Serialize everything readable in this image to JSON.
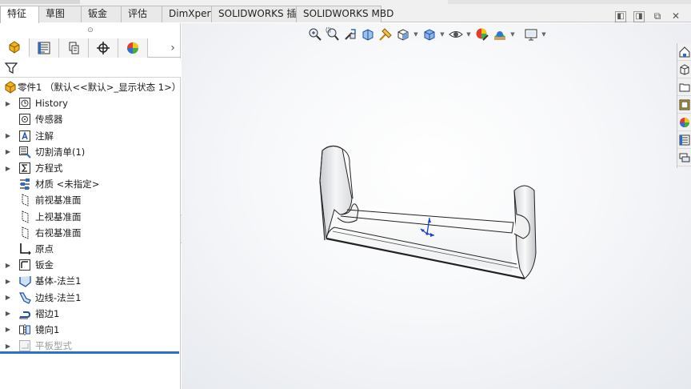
{
  "command_tabs": [
    {
      "label": "特征",
      "active": true
    },
    {
      "label": "草图",
      "active": false
    },
    {
      "label": "钣金",
      "active": false
    },
    {
      "label": "评估",
      "active": false
    },
    {
      "label": "DimXpert",
      "active": false
    },
    {
      "label": "SOLIDWORKS 插件",
      "active": false
    },
    {
      "label": "SOLIDWORKS MBD",
      "active": false
    }
  ],
  "feature_tree": {
    "root": {
      "label": "零件1 （默认<<默认>_显示状态 1>）",
      "icon": "part-icon"
    },
    "items": [
      {
        "label": "History",
        "icon": "history-icon",
        "expandable": true
      },
      {
        "label": "传感器",
        "icon": "sensor-icon",
        "expandable": false
      },
      {
        "label": "注解",
        "icon": "annotation-icon",
        "expandable": true
      },
      {
        "label": "切割清单(1)",
        "icon": "cut-list-icon",
        "expandable": true
      },
      {
        "label": "方程式",
        "icon": "equation-icon",
        "expandable": true
      },
      {
        "label": "材质 <未指定>",
        "icon": "material-icon",
        "expandable": false
      },
      {
        "label": "前视基准面",
        "icon": "plane-icon",
        "expandable": false
      },
      {
        "label": "上视基准面",
        "icon": "plane-icon",
        "expandable": false
      },
      {
        "label": "右视基准面",
        "icon": "plane-icon",
        "expandable": false
      },
      {
        "label": "原点",
        "icon": "origin-icon",
        "expandable": false
      },
      {
        "label": "钣金",
        "icon": "sheet-metal-icon",
        "expandable": true
      },
      {
        "label": "基体-法兰1",
        "icon": "base-flange-icon",
        "expandable": true
      },
      {
        "label": "边线-法兰1",
        "icon": "edge-flange-icon",
        "expandable": true
      },
      {
        "label": "褶边1",
        "icon": "hem-icon",
        "expandable": true
      },
      {
        "label": "镜向1",
        "icon": "mirror-icon",
        "expandable": true
      },
      {
        "label": "平板型式",
        "icon": "flat-pattern-icon",
        "expandable": true,
        "suppressed": true
      }
    ]
  },
  "panel_tabs": [
    "feature-manager-icon",
    "property-manager-icon",
    "configuration-manager-icon",
    "dimxpert-manager-icon",
    "display-manager-icon"
  ],
  "heads_up_toolbar": [
    "zoom-to-fit-icon",
    "zoom-to-area-icon",
    "previous-view-icon",
    "section-view-icon",
    "dynamic-annotation-icon",
    "view-orientation-icon",
    "display-style-icon",
    "hide-show-icon",
    "edit-appearance-icon",
    "apply-scene-icon",
    "view-settings-icon"
  ],
  "task_pane": [
    "home-icon",
    "design-library-icon",
    "file-explorer-icon",
    "view-palette-icon",
    "appearances-icon",
    "custom-properties-icon",
    "forum-icon"
  ],
  "colors": {
    "accent": "#2a6fc9",
    "tab_bg": "#f0f0f0",
    "model_edge": "#222222"
  }
}
